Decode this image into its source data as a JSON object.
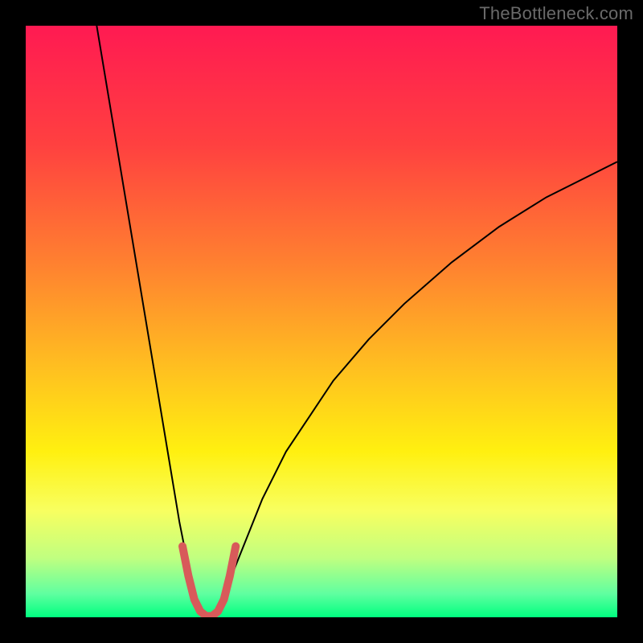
{
  "watermark": "TheBottleneck.com",
  "chart_data": {
    "type": "line",
    "title": "",
    "xlabel": "",
    "ylabel": "",
    "xlim": [
      0,
      100
    ],
    "ylim": [
      0,
      100
    ],
    "background_gradient": {
      "direction": "vertical",
      "stops": [
        {
          "pos": 0.0,
          "color": "#ff1a52"
        },
        {
          "pos": 0.2,
          "color": "#ff4040"
        },
        {
          "pos": 0.4,
          "color": "#ff8030"
        },
        {
          "pos": 0.58,
          "color": "#ffc020"
        },
        {
          "pos": 0.72,
          "color": "#fff010"
        },
        {
          "pos": 0.82,
          "color": "#f8ff60"
        },
        {
          "pos": 0.9,
          "color": "#c0ff80"
        },
        {
          "pos": 0.96,
          "color": "#60ffa0"
        },
        {
          "pos": 1.0,
          "color": "#00ff80"
        }
      ]
    },
    "series": [
      {
        "name": "curve-left",
        "stroke": "#000000",
        "stroke_width": 2,
        "x": [
          12,
          14,
          16,
          18,
          20,
          22,
          24,
          25,
          26,
          27,
          28,
          29,
          30
        ],
        "y": [
          100,
          88,
          76,
          64,
          52,
          40,
          28,
          22,
          16,
          11,
          6,
          2,
          0
        ]
      },
      {
        "name": "curve-right",
        "stroke": "#000000",
        "stroke_width": 2,
        "x": [
          32,
          33,
          34,
          36,
          38,
          40,
          44,
          48,
          52,
          58,
          64,
          72,
          80,
          88,
          96,
          100
        ],
        "y": [
          0,
          2,
          5,
          10,
          15,
          20,
          28,
          34,
          40,
          47,
          53,
          60,
          66,
          71,
          75,
          77
        ]
      },
      {
        "name": "marker-u",
        "stroke": "#d85a5a",
        "stroke_width": 10,
        "linecap": "round",
        "x": [
          26.5,
          27.5,
          28.5,
          29.5,
          30.5,
          31.5,
          32.5,
          33.5,
          34.5,
          35.5
        ],
        "y": [
          12,
          7,
          3,
          1,
          0.2,
          0.2,
          1,
          3,
          7,
          12
        ]
      }
    ]
  }
}
